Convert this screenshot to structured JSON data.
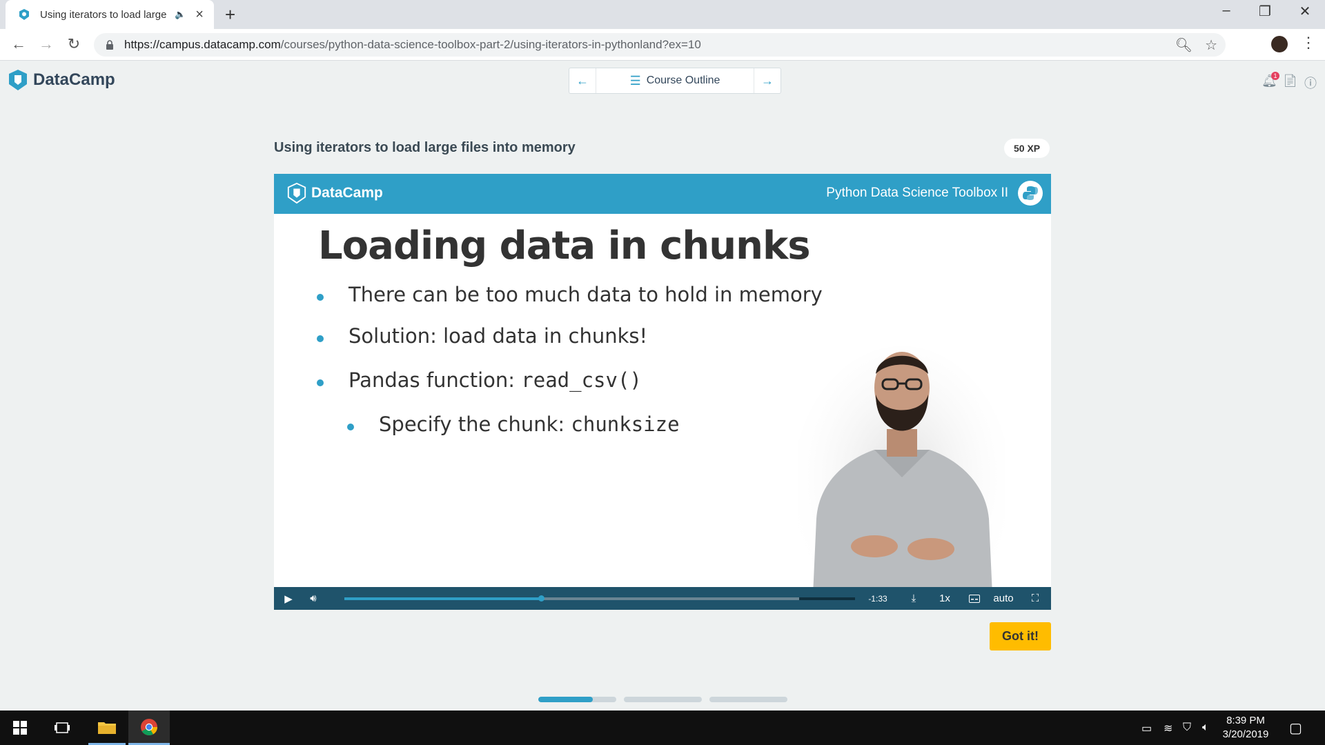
{
  "browser": {
    "tab_title": "Using iterators to load large",
    "url_host": "https://campus.datacamp.com",
    "url_path": "/courses/python-data-science-toolbox-part-2/using-iterators-in-pythonland?ex=10"
  },
  "header": {
    "logo_text": "DataCamp",
    "course_outline_label": "Course Outline",
    "notification_count": "1"
  },
  "exercise": {
    "title": "Using iterators to load large files into memory",
    "xp": "50 XP",
    "got_it_label": "Got it!"
  },
  "video": {
    "brand": "DataCamp",
    "course_name": "Python Data Science Toolbox II",
    "slide_title": "Loading data in chunks",
    "bullets": {
      "b1": "There can be too much data to hold in memory",
      "b2": "Solution: load data in chunks!",
      "b3_text": "Pandas function: ",
      "b3_code": "read_csv()",
      "b4_text": "Specify the chunk: ",
      "b4_code": "chunksize"
    },
    "time_remaining": "-1:33",
    "speed": "1x",
    "quality": "auto",
    "played_fraction": 0.385,
    "buffered_fraction": 0.89
  },
  "steps": {
    "current_step_fill_fraction": 0.7,
    "count": 3
  },
  "taskbar": {
    "time": "8:39 PM",
    "date": "3/20/2019"
  },
  "colors": {
    "accent": "#2f9fc7",
    "controls_bg": "#1f536b",
    "got_it": "#ffbc00",
    "page_bg": "#eef1f1"
  }
}
